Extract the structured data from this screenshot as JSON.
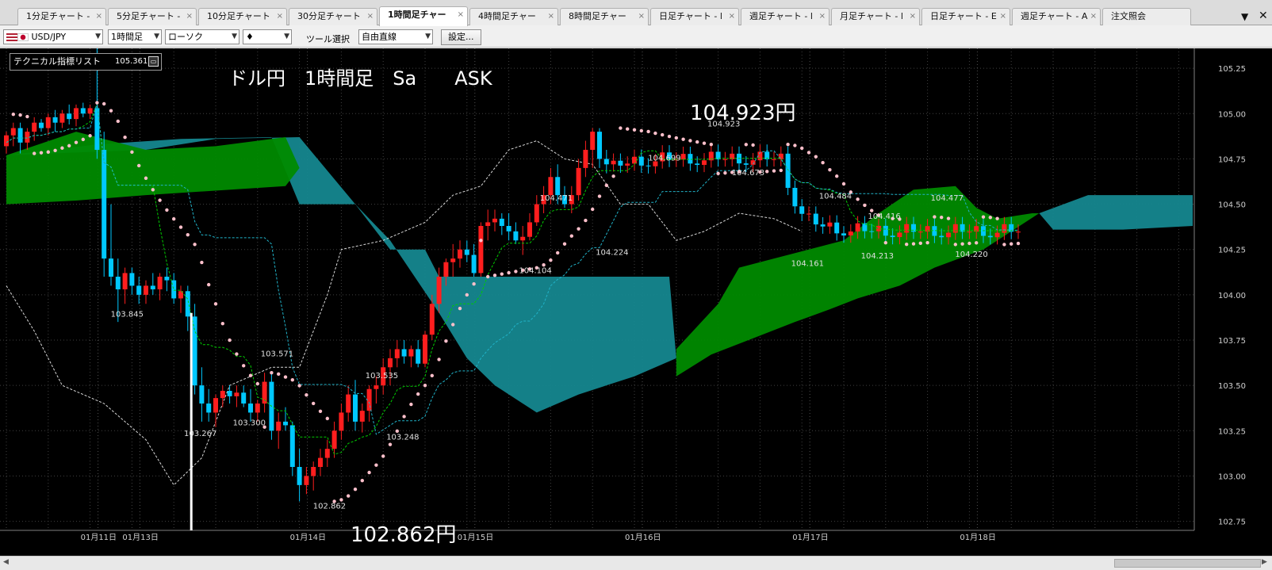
{
  "tabs": [
    {
      "label": "1分足チャート -",
      "active": false
    },
    {
      "label": "5分足チャート -",
      "active": false
    },
    {
      "label": "10分足チャート",
      "active": false
    },
    {
      "label": "30分足チャート",
      "active": false
    },
    {
      "label": "1時間足チャー",
      "active": true
    },
    {
      "label": "4時間足チャー",
      "active": false
    },
    {
      "label": "8時間足チャー",
      "active": false
    },
    {
      "label": "日足チャート - l",
      "active": false
    },
    {
      "label": "週足チャート - l",
      "active": false
    },
    {
      "label": "月足チャート - l",
      "active": false
    },
    {
      "label": "日足チャート - E",
      "active": false
    },
    {
      "label": "週足チャート - A",
      "active": false
    },
    {
      "label": "注文照会",
      "active": false
    }
  ],
  "tab_close_glyph": "×",
  "tab_menu_glyph": "▼",
  "tab_x_glyph": "✕",
  "toolbar": {
    "symbol": "USD/JPY",
    "timeframe": "1時間足",
    "chart_type": "ローソク",
    "candle_glyph": "♦",
    "tool_label": "ツール選択",
    "tool_value": "自由直線",
    "settings_button": "設定..."
  },
  "indicator_box": {
    "label": "テクニカル指標リスト",
    "value": "105.361"
  },
  "colors": {
    "bg": "#000000",
    "up": "#ff1e1e",
    "down": "#00c8ff",
    "cloud_bull": "#008a00",
    "cloud_bear": "#15878f",
    "tenkan": "#00cc00",
    "kijun": "#20b2c8",
    "chikou": "#d8d8d8",
    "sar": "#ffc0cb",
    "grid": "#404040",
    "white_line": "#ffffff"
  },
  "chart_data": {
    "type": "candlestick",
    "title": "ドル円　1時間足　Sa　　ASK",
    "instrument": "USD/JPY",
    "timeframe": "1時間足",
    "ylim": [
      102.7,
      105.36
    ],
    "y_ticks": [
      "105.25",
      "105.00",
      "104.75",
      "104.50",
      "104.25",
      "104.00",
      "103.75",
      "103.50",
      "103.25",
      "103.00",
      "102.75"
    ],
    "x_ticks": [
      {
        "label": "01月11日",
        "i": 12
      },
      {
        "label": "01月13日",
        "i": 18
      },
      {
        "label": "01月14日",
        "i": 42
      },
      {
        "label": "01月15日",
        "i": 66
      },
      {
        "label": "01月16日",
        "i": 90
      },
      {
        "label": "01月17日",
        "i": 114
      },
      {
        "label": "01月18日",
        "i": 138
      }
    ],
    "highlights": {
      "high": "104.923円",
      "low": "102.862円"
    },
    "price_labels": [
      {
        "text": "105.361",
        "i": 16.5,
        "y": 105.36
      },
      {
        "text": "103.845",
        "i": 17,
        "y": 103.88
      },
      {
        "text": "103.267",
        "i": 27.5,
        "y": 103.22
      },
      {
        "text": "103.300",
        "i": 34.5,
        "y": 103.28
      },
      {
        "text": "103.571",
        "i": 38.5,
        "y": 103.66
      },
      {
        "text": "103.535",
        "i": 53.5,
        "y": 103.54
      },
      {
        "text": "103.248",
        "i": 56.5,
        "y": 103.2
      },
      {
        "text": "102.862",
        "i": 46,
        "y": 102.82
      },
      {
        "text": "104.104",
        "i": 75.5,
        "y": 104.12
      },
      {
        "text": "104.471",
        "i": 78.5,
        "y": 104.52
      },
      {
        "text": "104.224",
        "i": 86.5,
        "y": 104.22
      },
      {
        "text": "104.699",
        "i": 94,
        "y": 104.74
      },
      {
        "text": "104.923",
        "i": 102.5,
        "y": 104.93
      },
      {
        "text": "104.673",
        "i": 106,
        "y": 104.66
      },
      {
        "text": "104.484",
        "i": 118.5,
        "y": 104.53
      },
      {
        "text": "104.416",
        "i": 125.5,
        "y": 104.42
      },
      {
        "text": "104.161",
        "i": 114.5,
        "y": 104.16
      },
      {
        "text": "104.213",
        "i": 124.5,
        "y": 104.2
      },
      {
        "text": "104.477",
        "i": 134.5,
        "y": 104.52
      },
      {
        "text": "104.220",
        "i": 138,
        "y": 104.21
      }
    ],
    "white_line": {
      "i": 26.5,
      "y": [
        103.9,
        102.7
      ]
    },
    "candles": [
      [
        104.82,
        104.9,
        104.78,
        104.88
      ],
      [
        104.88,
        104.95,
        104.82,
        104.92
      ],
      [
        104.92,
        104.95,
        104.78,
        104.84
      ],
      [
        104.84,
        104.92,
        104.8,
        104.9
      ],
      [
        104.9,
        104.98,
        104.85,
        104.95
      ],
      [
        104.95,
        104.97,
        104.9,
        104.92
      ],
      [
        104.92,
        105.0,
        104.88,
        104.98
      ],
      [
        104.98,
        105.02,
        104.9,
        104.95
      ],
      [
        104.95,
        105.02,
        104.92,
        105.0
      ],
      [
        105.0,
        105.05,
        104.94,
        104.97
      ],
      [
        104.97,
        105.05,
        104.93,
        105.03
      ],
      [
        105.03,
        105.06,
        104.98,
        105.0
      ],
      [
        105.0,
        105.05,
        104.97,
        105.03
      ],
      [
        105.03,
        105.36,
        104.75,
        104.8
      ],
      [
        104.8,
        104.9,
        104.1,
        104.2
      ],
      [
        104.2,
        104.5,
        104.05,
        104.1
      ],
      [
        104.1,
        104.2,
        103.85,
        104.03
      ],
      [
        104.03,
        104.15,
        103.95,
        104.12
      ],
      [
        104.12,
        104.15,
        104.0,
        104.05
      ],
      [
        104.05,
        104.1,
        103.95,
        104.0
      ],
      [
        104.0,
        104.08,
        103.95,
        104.05
      ],
      [
        104.05,
        104.12,
        104.0,
        104.03
      ],
      [
        104.03,
        104.12,
        103.97,
        104.1
      ],
      [
        104.1,
        104.15,
        104.02,
        104.08
      ],
      [
        104.08,
        104.12,
        103.95,
        103.98
      ],
      [
        103.98,
        104.05,
        103.9,
        104.02
      ],
      [
        104.02,
        104.05,
        103.8,
        103.88
      ],
      [
        103.88,
        103.95,
        103.45,
        103.5
      ],
      [
        103.5,
        103.6,
        103.3,
        103.4
      ],
      [
        103.4,
        103.48,
        103.3,
        103.35
      ],
      [
        103.35,
        103.45,
        103.27,
        103.43
      ],
      [
        103.43,
        103.5,
        103.38,
        103.47
      ],
      [
        103.47,
        103.5,
        103.4,
        103.44
      ],
      [
        103.44,
        103.5,
        103.38,
        103.46
      ],
      [
        103.46,
        103.5,
        103.38,
        103.4
      ],
      [
        103.4,
        103.48,
        103.3,
        103.35
      ],
      [
        103.35,
        103.42,
        103.3,
        103.4
      ],
      [
        103.4,
        103.57,
        103.35,
        103.52
      ],
      [
        103.52,
        103.57,
        103.2,
        103.25
      ],
      [
        103.25,
        103.35,
        103.15,
        103.3
      ],
      [
        103.3,
        103.38,
        103.25,
        103.28
      ],
      [
        103.28,
        103.3,
        103.0,
        103.05
      ],
      [
        103.05,
        103.15,
        102.86,
        102.95
      ],
      [
        102.95,
        103.05,
        102.9,
        103.0
      ],
      [
        103.0,
        103.08,
        102.92,
        103.05
      ],
      [
        103.05,
        103.15,
        103.0,
        103.1
      ],
      [
        103.1,
        103.2,
        103.05,
        103.15
      ],
      [
        103.15,
        103.3,
        103.1,
        103.25
      ],
      [
        103.25,
        103.4,
        103.2,
        103.35
      ],
      [
        103.35,
        103.5,
        103.3,
        103.45
      ],
      [
        103.45,
        103.53,
        103.25,
        103.3
      ],
      [
        103.3,
        103.4,
        103.24,
        103.36
      ],
      [
        103.36,
        103.5,
        103.3,
        103.48
      ],
      [
        103.48,
        103.55,
        103.4,
        103.5
      ],
      [
        103.5,
        103.65,
        103.45,
        103.6
      ],
      [
        103.6,
        103.7,
        103.5,
        103.65
      ],
      [
        103.65,
        103.75,
        103.6,
        103.7
      ],
      [
        103.7,
        103.75,
        103.62,
        103.66
      ],
      [
        103.66,
        103.72,
        103.6,
        103.7
      ],
      [
        103.7,
        103.75,
        103.6,
        103.62
      ],
      [
        103.62,
        103.8,
        103.6,
        103.78
      ],
      [
        103.78,
        104.0,
        103.75,
        103.95
      ],
      [
        103.95,
        104.15,
        103.9,
        104.1
      ],
      [
        104.1,
        104.2,
        104.05,
        104.18
      ],
      [
        104.18,
        104.28,
        104.1,
        104.2
      ],
      [
        104.2,
        104.3,
        104.15,
        104.25
      ],
      [
        104.25,
        104.3,
        104.18,
        104.22
      ],
      [
        104.22,
        104.28,
        104.1,
        104.12
      ],
      [
        104.12,
        104.4,
        104.1,
        104.38
      ],
      [
        104.38,
        104.47,
        104.3,
        104.4
      ],
      [
        104.4,
        104.47,
        104.35,
        104.42
      ],
      [
        104.42,
        104.45,
        104.33,
        104.38
      ],
      [
        104.38,
        104.45,
        104.3,
        104.35
      ],
      [
        104.35,
        104.4,
        104.28,
        104.3
      ],
      [
        104.3,
        104.38,
        104.22,
        104.32
      ],
      [
        104.32,
        104.45,
        104.3,
        104.4
      ],
      [
        104.4,
        104.55,
        104.38,
        104.5
      ],
      [
        104.5,
        104.6,
        104.45,
        104.55
      ],
      [
        104.55,
        104.7,
        104.5,
        104.65
      ],
      [
        104.65,
        104.72,
        104.5,
        104.55
      ],
      [
        104.55,
        104.6,
        104.48,
        104.5
      ],
      [
        104.5,
        104.6,
        104.45,
        104.55
      ],
      [
        104.55,
        104.75,
        104.52,
        104.7
      ],
      [
        104.7,
        104.85,
        104.65,
        104.8
      ],
      [
        104.8,
        104.92,
        104.7,
        104.9
      ],
      [
        104.9,
        104.92,
        104.7,
        104.75
      ],
      [
        104.75,
        104.8,
        104.67,
        104.72
      ],
      [
        104.72,
        104.78,
        104.68,
        104.74
      ]
    ]
  }
}
